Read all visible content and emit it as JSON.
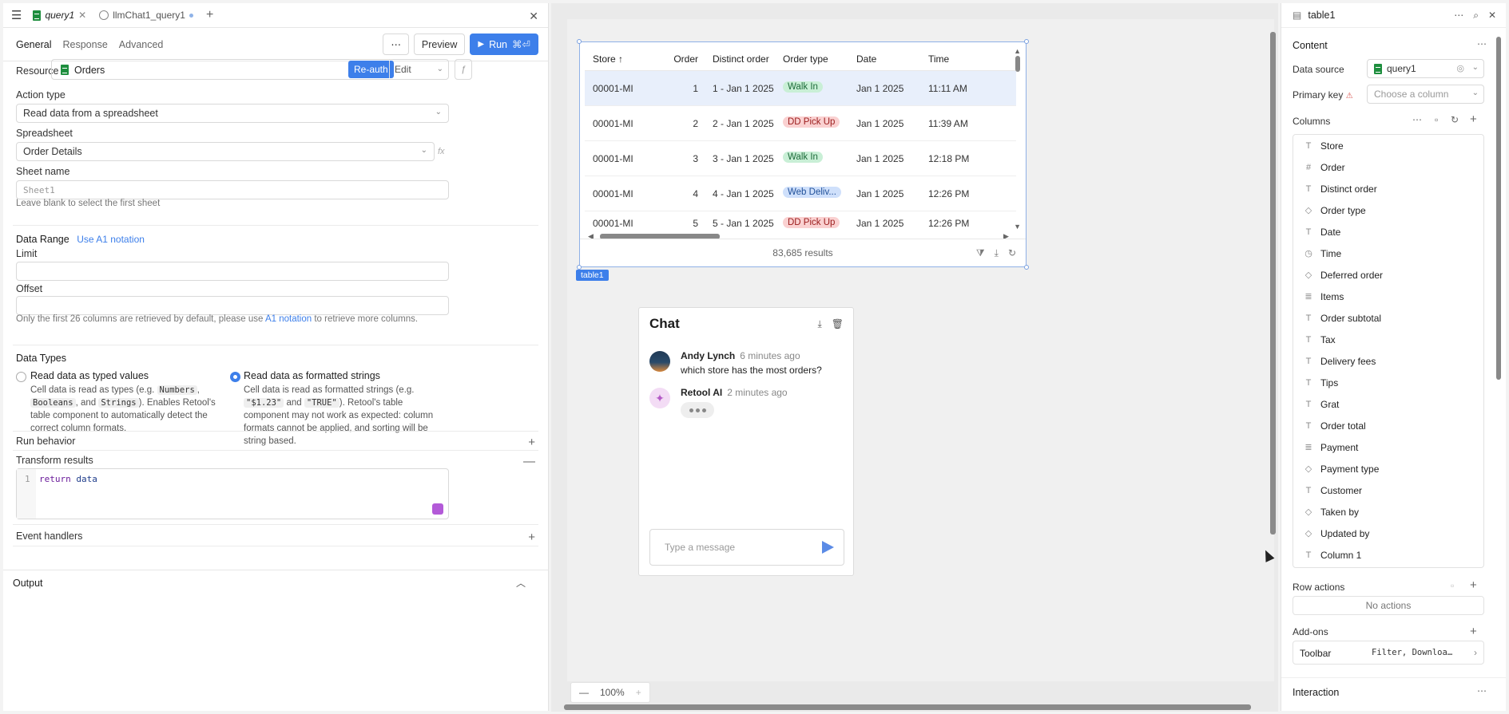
{
  "tabs": {
    "query1": "query1",
    "llm": "llmChat1_query1"
  },
  "subtabs": [
    "General",
    "Response",
    "Advanced"
  ],
  "toolbar": {
    "preview": "Preview",
    "run": "Run",
    "run_shortcut": "⌘⏎"
  },
  "resource": {
    "label": "Resource",
    "name": "Orders",
    "reauth": "Re-auth",
    "edit": "Edit"
  },
  "action_type": {
    "label": "Action type",
    "value": "Read data from a spreadsheet"
  },
  "spreadsheet": {
    "label": "Spreadsheet",
    "value": "Order Details"
  },
  "sheet_name": {
    "label": "Sheet name",
    "placeholder": "Sheet1",
    "hint": "Leave blank to select the first sheet"
  },
  "data_range": {
    "title": "Data Range",
    "link": "Use A1 notation",
    "limit_label": "Limit",
    "offset_label": "Offset",
    "hint_pre": "Only the first 26 columns are retrieved by default, please use ",
    "hint_link": "A1 notation",
    "hint_post": " to retrieve more columns."
  },
  "data_types": {
    "title": "Data Types",
    "opt1_title": "Read data as typed values",
    "opt1_a": "Cell data is read as types (e.g. ",
    "opt1_c1": "Numbers",
    "opt1_c2": "Booleans",
    "opt1_and": ", and ",
    "opt1_c3": "Strings",
    "opt1_b": "). Enables Retool's table component to automatically detect the correct column formats.",
    "opt2_title": "Read data as formatted strings",
    "opt2_a": "Cell data is read as formatted strings (e.g. ",
    "opt2_c1": "\"$1.23\"",
    "opt2_and": " and ",
    "opt2_c2": "\"TRUE\"",
    "opt2_b": "). Retool's table component may not work as expected: column formats cannot be applied, and sorting will be string based."
  },
  "run_behavior": "Run behavior",
  "transform": {
    "title": "Transform results",
    "line_no": "1",
    "code_kw": "return",
    "code_rest": " data"
  },
  "event_handlers": "Event handlers",
  "output": "Output",
  "table": {
    "name": "table1",
    "headers": [
      "Store ↑",
      "Order",
      "Distinct order",
      "Order type",
      "Date",
      "Time"
    ],
    "rows": [
      [
        "00001-MI",
        "1",
        "1 - Jan 1 2025",
        "Walk In",
        "Jan 1 2025",
        "11:11 AM"
      ],
      [
        "00001-MI",
        "2",
        "2 - Jan 1 2025",
        "DD Pick Up",
        "Jan 1 2025",
        "11:39 AM"
      ],
      [
        "00001-MI",
        "3",
        "3 - Jan 1 2025",
        "Walk In",
        "Jan 1 2025",
        "12:18 PM"
      ],
      [
        "00001-MI",
        "4",
        "4 - Jan 1 2025",
        "Web Deliv...",
        "Jan 1 2025",
        "12:26 PM"
      ],
      [
        "00001-MI",
        "5",
        "5 - Jan 1 2025",
        "DD Pick Up",
        "Jan 1 2025",
        "12:26 PM"
      ]
    ],
    "results": "83,685 results"
  },
  "chat": {
    "title": "Chat",
    "user_name": "Andy Lynch",
    "user_time": "6 minutes ago",
    "user_msg": "which store has the most orders?",
    "ai_name": "Retool AI",
    "ai_time": "2 minutes ago",
    "input_placeholder": "Type a message"
  },
  "zoom": {
    "level": "100%"
  },
  "inspector": {
    "title": "table1",
    "content": "Content",
    "data_source_label": "Data source",
    "data_source_value": "query1",
    "primary_key_label": "Primary key",
    "primary_key_placeholder": "Choose a column",
    "columns_label": "Columns",
    "columns": [
      {
        "name": "Store",
        "icon": "T"
      },
      {
        "name": "Order",
        "icon": "#"
      },
      {
        "name": "Distinct order",
        "icon": "T"
      },
      {
        "name": "Order type",
        "icon": "tag"
      },
      {
        "name": "Date",
        "icon": "T"
      },
      {
        "name": "Time",
        "icon": "clock"
      },
      {
        "name": "Deferred order",
        "icon": "tag"
      },
      {
        "name": "Items",
        "icon": "list"
      },
      {
        "name": "Order subtotal",
        "icon": "T"
      },
      {
        "name": "Tax",
        "icon": "T"
      },
      {
        "name": "Delivery fees",
        "icon": "T"
      },
      {
        "name": "Tips",
        "icon": "T"
      },
      {
        "name": "Grat",
        "icon": "T"
      },
      {
        "name": "Order total",
        "icon": "T"
      },
      {
        "name": "Payment",
        "icon": "list"
      },
      {
        "name": "Payment type",
        "icon": "tag"
      },
      {
        "name": "Customer",
        "icon": "T"
      },
      {
        "name": "Taken by",
        "icon": "tag"
      },
      {
        "name": "Updated by",
        "icon": "tag"
      },
      {
        "name": "Column 1",
        "icon": "T"
      }
    ],
    "row_actions": "Row actions",
    "no_actions": "No actions",
    "addons": "Add-ons",
    "toolbar_label": "Toolbar",
    "toolbar_value": "Filter, Downloa…",
    "interaction": "Interaction"
  }
}
